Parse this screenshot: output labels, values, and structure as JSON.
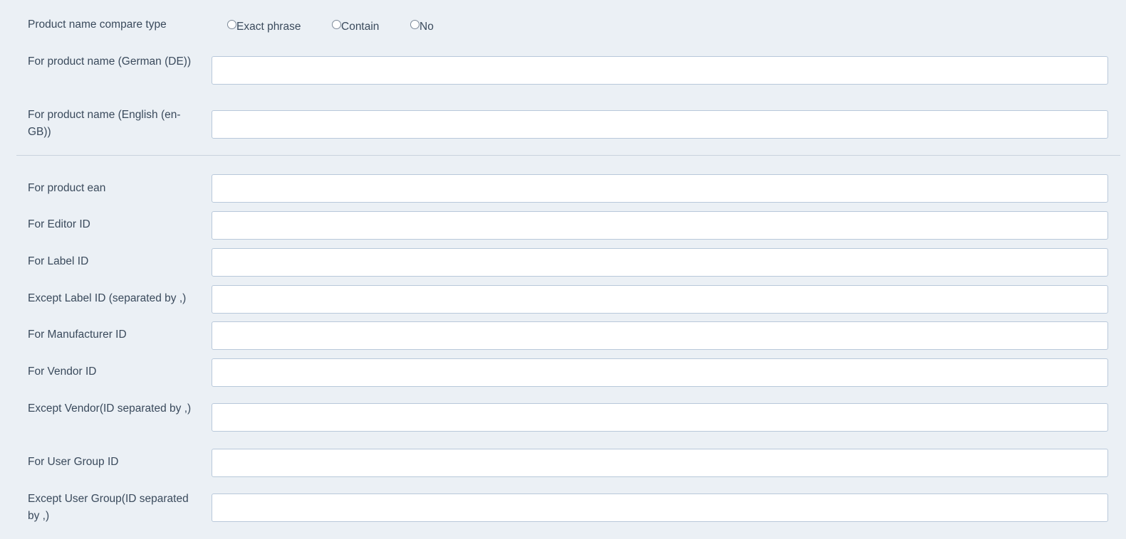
{
  "compare_type": {
    "label": "Product name compare type",
    "options": [
      "Exact phrase",
      "Contain",
      "No"
    ],
    "selected": null
  },
  "fields": [
    {
      "label": "For product name (German (DE))",
      "value": "",
      "placeholder": ""
    },
    {
      "label": "For product name (English (en-GB))",
      "value": "",
      "placeholder": ""
    },
    {
      "label": "For product ean",
      "value": "",
      "placeholder": ""
    },
    {
      "label": "For Editor ID",
      "value": "",
      "placeholder": ""
    },
    {
      "label": "For Label ID",
      "value": "",
      "placeholder": ""
    },
    {
      "label": "Except Label ID (separated by ,)",
      "value": "",
      "placeholder": ""
    },
    {
      "label": "For Manufacturer ID",
      "value": "",
      "placeholder": ""
    },
    {
      "label": "For Vendor ID",
      "value": "",
      "placeholder": ""
    },
    {
      "label": "Except Vendor(ID separated by ,)",
      "value": "",
      "placeholder": ""
    },
    {
      "label": "For User Group ID",
      "value": "",
      "placeholder": ""
    },
    {
      "label": "Except User Group(ID separated by ,)",
      "value": "",
      "placeholder": ""
    }
  ],
  "colors": {
    "background": "#ebf0f5",
    "input_border": "#b8c8da",
    "text": "#3a4a5c"
  }
}
